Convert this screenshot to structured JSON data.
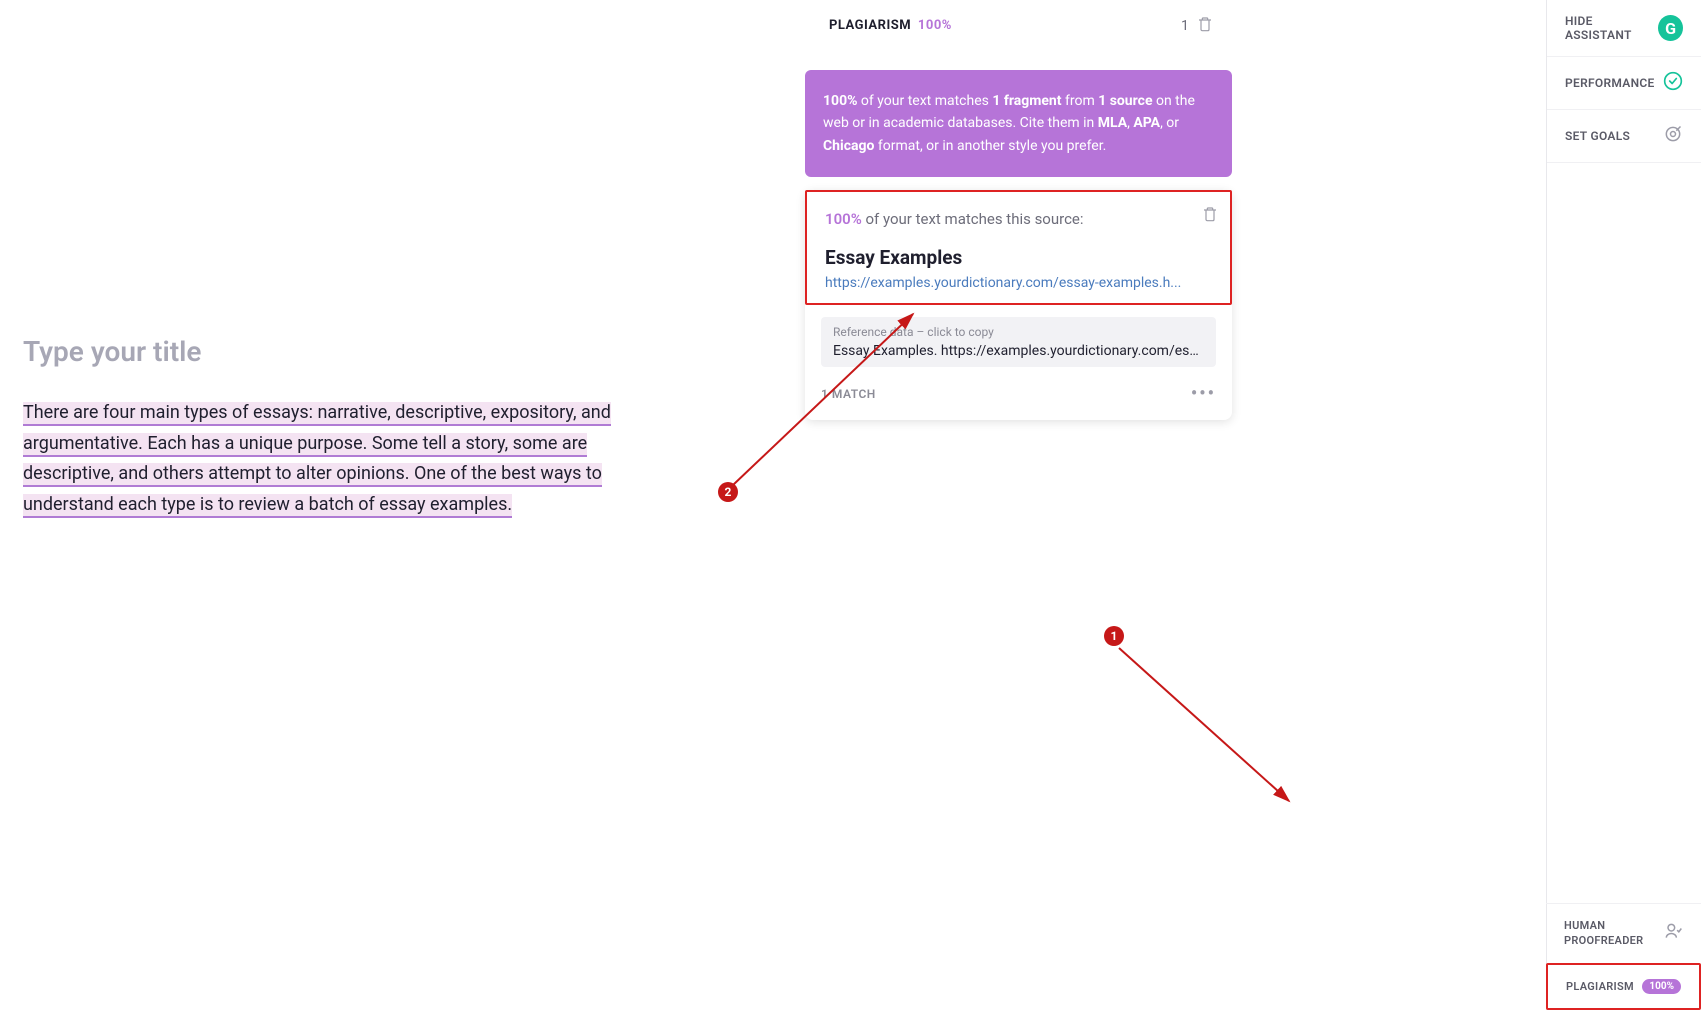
{
  "editor": {
    "title_placeholder": "Type your title",
    "body_text": "There are four main types of essays: narrative, descriptive, expository, and argumentative. Each has a unique purpose. Some tell a story, some are descriptive, and others attempt to alter opinions. One of the best ways to understand each type is to review a batch of essay examples."
  },
  "header": {
    "plagiarism_label": "PLAGIARISM",
    "plagiarism_pct": "100%",
    "count": "1"
  },
  "banner": {
    "pct": "100%",
    "text_1": " of your text matches ",
    "fragment": "1 fragment",
    "text_2": " from ",
    "source": "1 source",
    "text_3": " on the web or in academic databases. Cite them in ",
    "mla": "MLA",
    "sep1": ", ",
    "apa": "APA",
    "sep2": ", or ",
    "chicago": "Chicago",
    "text_4": " format, or in another style you prefer."
  },
  "source_card": {
    "pct": "100%",
    "pct_suffix": " of your text matches this source:",
    "title": "Essay Examples",
    "url": "https://examples.yourdictionary.com/essay-examples.h...",
    "ref_label": "Reference data – click to copy",
    "ref_text": "Essay Examples. https://examples.yourdictionary.com/essay-...",
    "match_label": "1 MATCH"
  },
  "sidebar": {
    "hide_assistant": "HIDE ASSISTANT",
    "performance": "PERFORMANCE",
    "set_goals": "SET GOALS",
    "human_proofreader": "HUMAN PROOFREADER",
    "plagiarism": "PLAGIARISM",
    "plagiarism_badge": "100%"
  },
  "annotations": {
    "marker_1": "1",
    "marker_2": "2"
  }
}
